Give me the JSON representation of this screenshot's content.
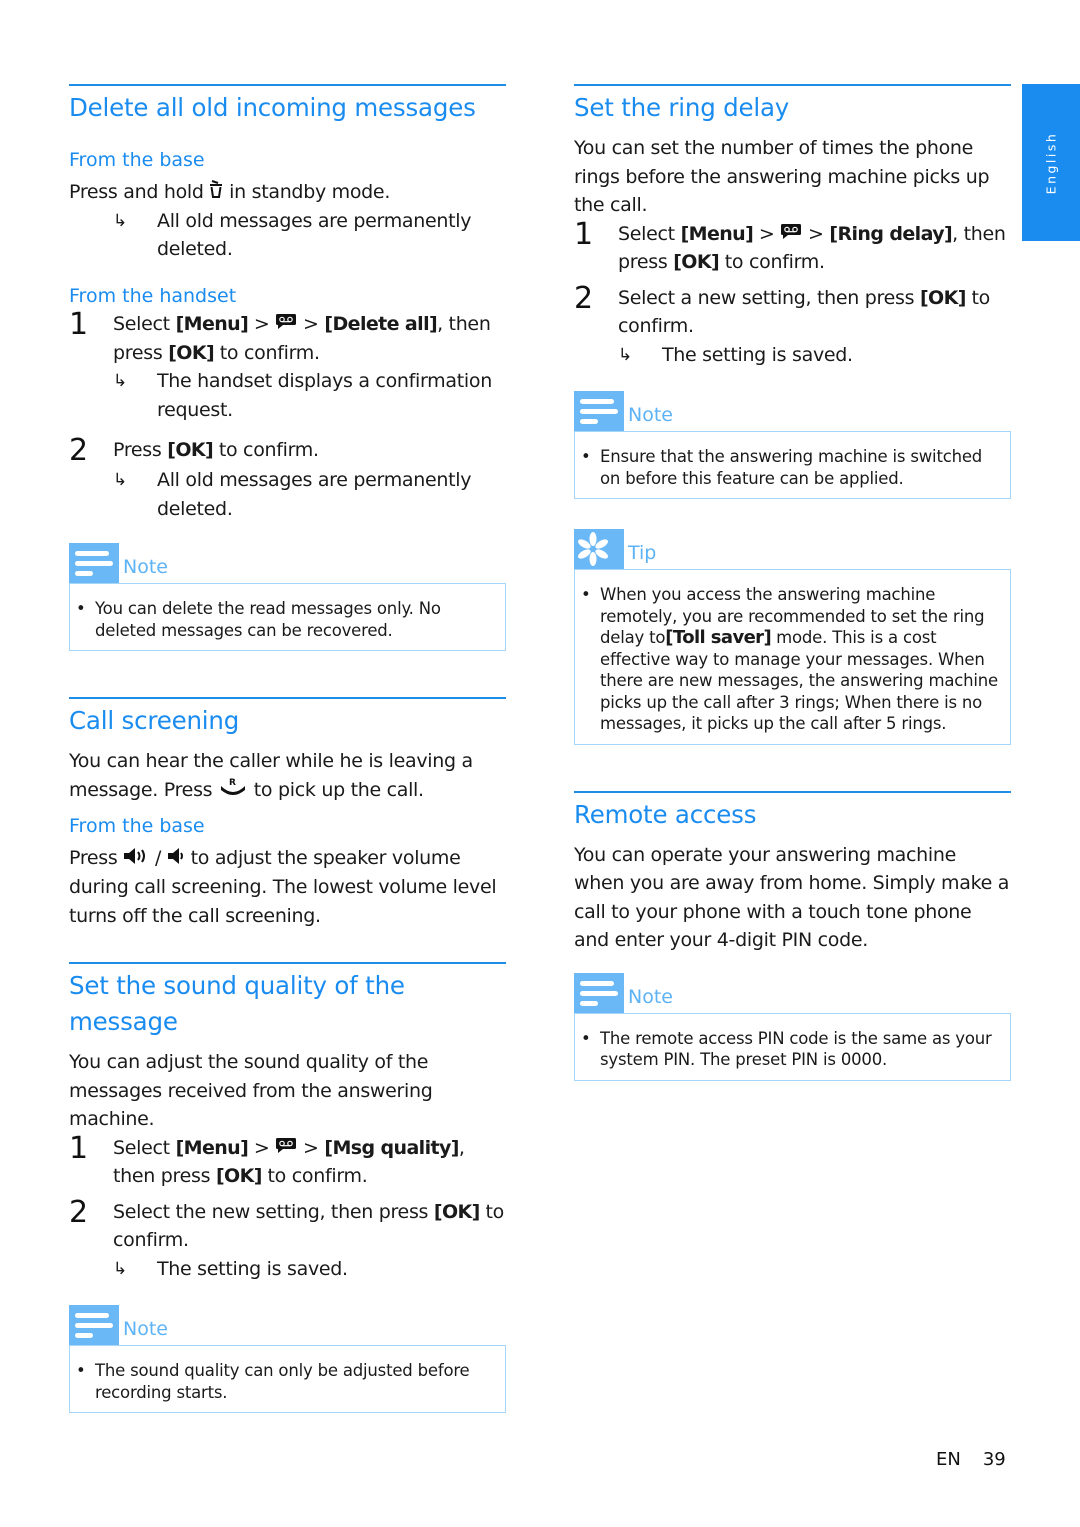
{
  "side_tab": {
    "label": "English"
  },
  "footer": {
    "lang": "EN",
    "page": "39"
  },
  "left": {
    "delete": {
      "title": "Delete all old incoming messages",
      "base": {
        "heading": "From the base",
        "text_before": "Press and hold",
        "icon": "trash-icon",
        "text_after": "in standby mode.",
        "result": "All old messages are permanently deleted."
      },
      "handset": {
        "heading": "From the handset",
        "steps": [
          {
            "num": "1",
            "t1": "Select ",
            "k1": "[Menu]",
            "t2": " > ",
            "icon": "answering-machine-icon",
            "t3": " > ",
            "k2": "[Delete all]",
            "t4": ", then press ",
            "k3": "[OK]",
            "t5": " to confirm.",
            "result": "The handset displays a confirmation request."
          },
          {
            "num": "2",
            "t1": "Press ",
            "k1": "[OK]",
            "t2": " to confirm.",
            "result": "All old messages are permanently deleted."
          }
        ]
      },
      "note": {
        "label": "Note",
        "text": "You can delete the read messages only. No deleted messages can be recovered."
      }
    },
    "screening": {
      "title": "Call screening",
      "intro_before": "You can hear the caller while he is leaving a message. Press",
      "intro_icon": "recall-pickup-icon",
      "intro_after": "to pick up the call.",
      "base": {
        "heading": "From the base",
        "text_before": "Press",
        "icon_up": "volume-up-icon",
        "sep": "/",
        "icon_down": "volume-down-icon",
        "text_after": "to adjust the speaker volume during call screening. The lowest volume level turns off the call screening."
      }
    },
    "quality": {
      "title": "Set the sound quality of the message",
      "intro": "You can adjust the sound quality of the messages received from the answering machine.",
      "steps": [
        {
          "num": "1",
          "t1": "Select ",
          "k1": "[Menu]",
          "t2": " > ",
          "t3": " > ",
          "k2": "[Msg quality]",
          "t4": ", then press ",
          "k3": "[OK]",
          "t5": " to confirm."
        },
        {
          "num": "2",
          "t1": "Select the new setting, then press ",
          "k1": "[OK]",
          "t2": " to confirm.",
          "result": "The setting is saved."
        }
      ],
      "note": {
        "label": "Note",
        "text": "The sound quality can only be adjusted before recording starts."
      }
    }
  },
  "right": {
    "ring": {
      "title": "Set the ring delay",
      "intro": "You can set the number of times the phone rings before the answering machine picks up the call.",
      "steps": [
        {
          "num": "1",
          "t1": "Select ",
          "k1": "[Menu]",
          "t2": " > ",
          "t3": " > ",
          "k2": "[Ring delay]",
          "t4": ", then press ",
          "k3": "[OK]",
          "t5": " to confirm."
        },
        {
          "num": "2",
          "t1": "Select a new setting, then press ",
          "k1": "[OK]",
          "t2": " to confirm.",
          "result": "The setting is saved."
        }
      ],
      "note": {
        "label": "Note",
        "text": "Ensure that the answering machine is switched on before this feature can be applied."
      },
      "tip": {
        "label": "Tip",
        "t1": "When you access the answering machine remotely, you are recommended to set the ring delay to",
        "k1": "[Toll saver]",
        "t2": " mode. This is a cost effective way to manage your messages. When there are new messages, the answering machine picks up the call after 3 rings; When there is no messages, it picks up the call after 5 rings."
      }
    },
    "remote": {
      "title": "Remote access",
      "intro": "You can operate your answering machine when you are away from home. Simply make a call to your phone with a touch tone phone and enter your 4-digit PIN code.",
      "note": {
        "label": "Note",
        "text": "The remote access PIN code is the same as your system PIN. The preset PIN is 0000."
      }
    }
  }
}
